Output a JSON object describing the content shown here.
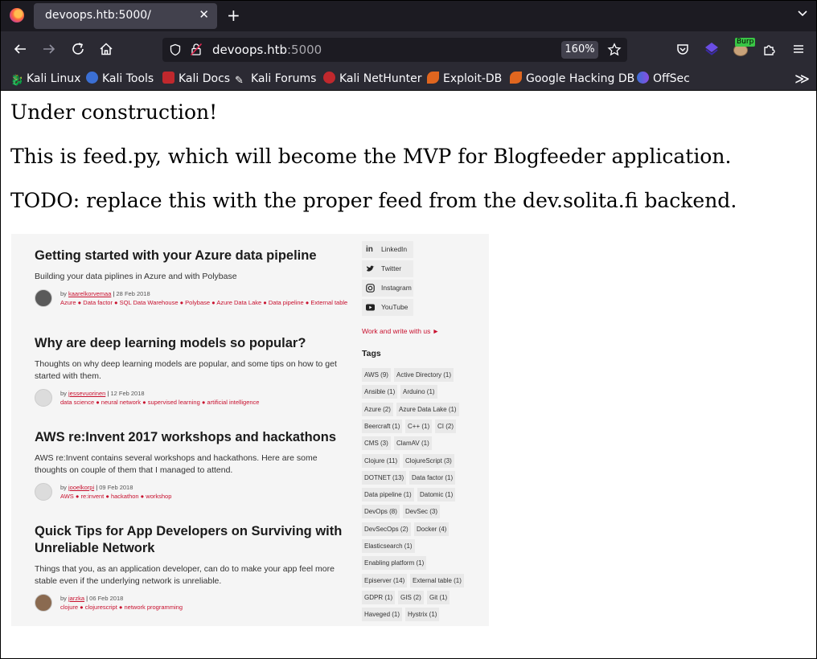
{
  "browser": {
    "tab_title": "devoops.htb:5000/",
    "url_host": "devoops.htb",
    "url_port": ":5000",
    "zoom": "160%",
    "bookmarks": [
      "Kali Linux",
      "Kali Tools",
      "Kali Docs",
      "Kali Forums",
      "Kali NetHunter",
      "Exploit-DB",
      "Google Hacking DB",
      "OffSec"
    ],
    "burp_badge": "Burp",
    "colors": {
      "tabbar": "#1c1b22",
      "toolbar": "#2b2a33",
      "urlbar": "#1c1b22",
      "accent": "#c8102e"
    }
  },
  "page": {
    "line1": "Under construction!",
    "line2": "This is feed.py, which will become the MVP for Blogfeeder application.",
    "line3": "TODO: replace this with the proper feed from the dev.solita.fi backend."
  },
  "feed": {
    "posts": [
      {
        "title": "Getting started with your Azure data pipeline",
        "desc": "Building your data piplines in Azure and with Polybase",
        "author": "kaarelkorvemaa",
        "date": "28 Feb 2018",
        "tags": "Azure ● Data factor ● SQL Data Warehouse ● Polybase ● Azure Data Lake ● Data pipeline ● External table"
      },
      {
        "title": "Why are deep learning models so popular?",
        "desc": "Thoughts on why deep learning models are popular, and some tips on how to get started with them.",
        "author": "jessevuorinen",
        "date": "12 Feb 2018",
        "tags": "data science ● neural network ● supervised learning ● artificial intelligence"
      },
      {
        "title": "AWS re:Invent 2017 workshops and hackathons",
        "desc": "AWS re:Invent contains several workshops and hackathons. Here are some thoughts on couple of them that I managed to attend.",
        "author": "jooelkorpi",
        "date": "09 Feb 2018",
        "tags": "AWS ● re:invent ● hackathon ● workshop"
      },
      {
        "title": "Quick Tips for App Developers on Surviving with Unreliable Network",
        "desc": "Things that you, as an application developer, can do to make your app feel more stable even if the underlying network is unreliable.",
        "author": "jarzka",
        "date": "06 Feb 2018",
        "tags": "clojure ● clojurescript ● network programming"
      }
    ],
    "by_prefix": "by",
    "social": [
      "LinkedIn",
      "Twitter",
      "Instagram",
      "YouTube"
    ],
    "work_link": "Work and write with us ►",
    "tags_heading": "Tags",
    "tags": [
      [
        "AWS (9)",
        "Active Directory (1)"
      ],
      [
        "Ansible (1)",
        "Arduino (1)"
      ],
      [
        "Azure (2)",
        "Azure Data Lake (1)"
      ],
      [
        "Beercraft (1)",
        "C++ (1)",
        "CI (2)"
      ],
      [
        "CMS (3)",
        "ClamAV (1)"
      ],
      [
        "Clojure (11)",
        "ClojureScript (3)"
      ],
      [
        "DOTNET (13)",
        "Data factor (1)"
      ],
      [
        "Data pipeline (1)",
        "Datomic (1)"
      ],
      [
        "DevOps (8)",
        "DevSec (3)"
      ],
      [
        "DevSecOps (2)",
        "Docker (4)"
      ],
      [
        "Elasticsearch (1)"
      ],
      [
        "Enabling platform (1)"
      ],
      [
        "Episerver (14)",
        "External table (1)"
      ],
      [
        "GDPR (1)",
        "GIS (2)",
        "Git (1)"
      ],
      [
        "Haveged (1)",
        "Hystrix (1)"
      ]
    ]
  }
}
